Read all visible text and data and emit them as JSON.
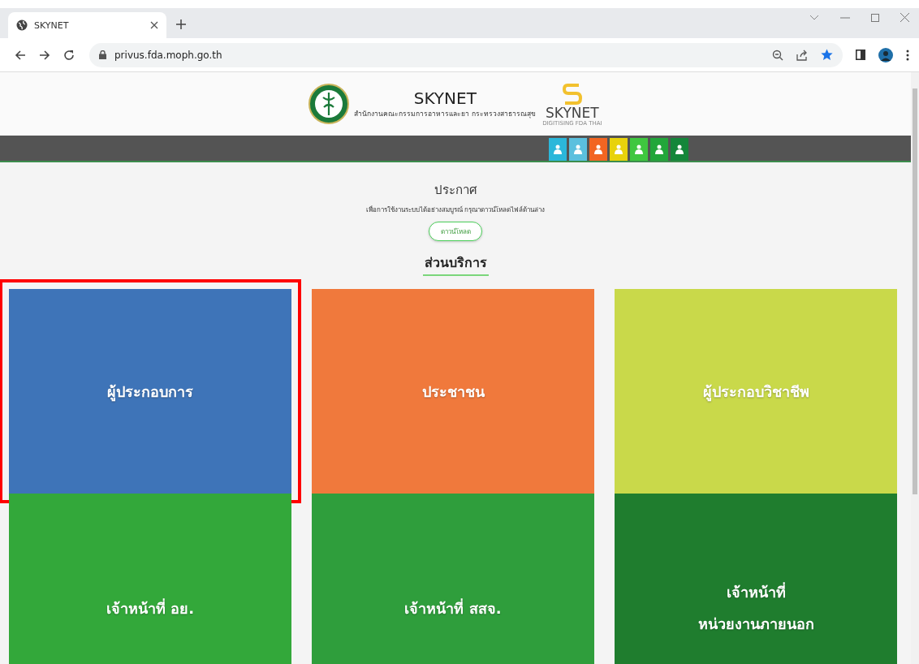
{
  "browser": {
    "tab_title": "SKYNET",
    "url": "privus.fda.moph.go.th"
  },
  "header": {
    "title": "SKYNET",
    "subtitle": "สำนักงานคณะกรรมการอาหารและยา กระทรวงสาธารณสุข",
    "logo_text": "SKYNET",
    "logo_tagline": "DIGITISING FDA THAI"
  },
  "nav_icons": [
    {
      "color": "#2bb7da"
    },
    {
      "color": "#5bc0de"
    },
    {
      "color": "#f26522"
    },
    {
      "color": "#e8d20c"
    },
    {
      "color": "#3fc73f"
    },
    {
      "color": "#22a63a"
    },
    {
      "color": "#14863a"
    }
  ],
  "announcement": {
    "title": "ประกาศ",
    "text": "เพื่อการใช้งานระบบได้อย่างสมบูรณ์ กรุณาดาวน์โหลดไฟล์ด้านล่าง",
    "button": "ดาวน์โหลด"
  },
  "services": {
    "heading": "ส่วนบริการ",
    "tiles": [
      {
        "lines": [
          "ผู้ประกอบการ"
        ],
        "color": "#3e74b8",
        "highlighted": true
      },
      {
        "lines": [
          "ประชาชน"
        ],
        "color": "#f0793c",
        "highlighted": false
      },
      {
        "lines": [
          "ผู้ประกอบวิชาชีพ"
        ],
        "color": "#c9d94a",
        "highlighted": false
      },
      {
        "lines": [
          "เจ้าหน้าที่ อย."
        ],
        "color": "#33a83a",
        "highlighted": false
      },
      {
        "lines": [
          "เจ้าหน้าที่ สสจ."
        ],
        "color": "#2f9e3c",
        "highlighted": false
      },
      {
        "lines": [
          "เจ้าหน้าที่",
          "หน่วยงานภายนอก"
        ],
        "color": "#1f7d2e",
        "highlighted": false
      }
    ]
  }
}
